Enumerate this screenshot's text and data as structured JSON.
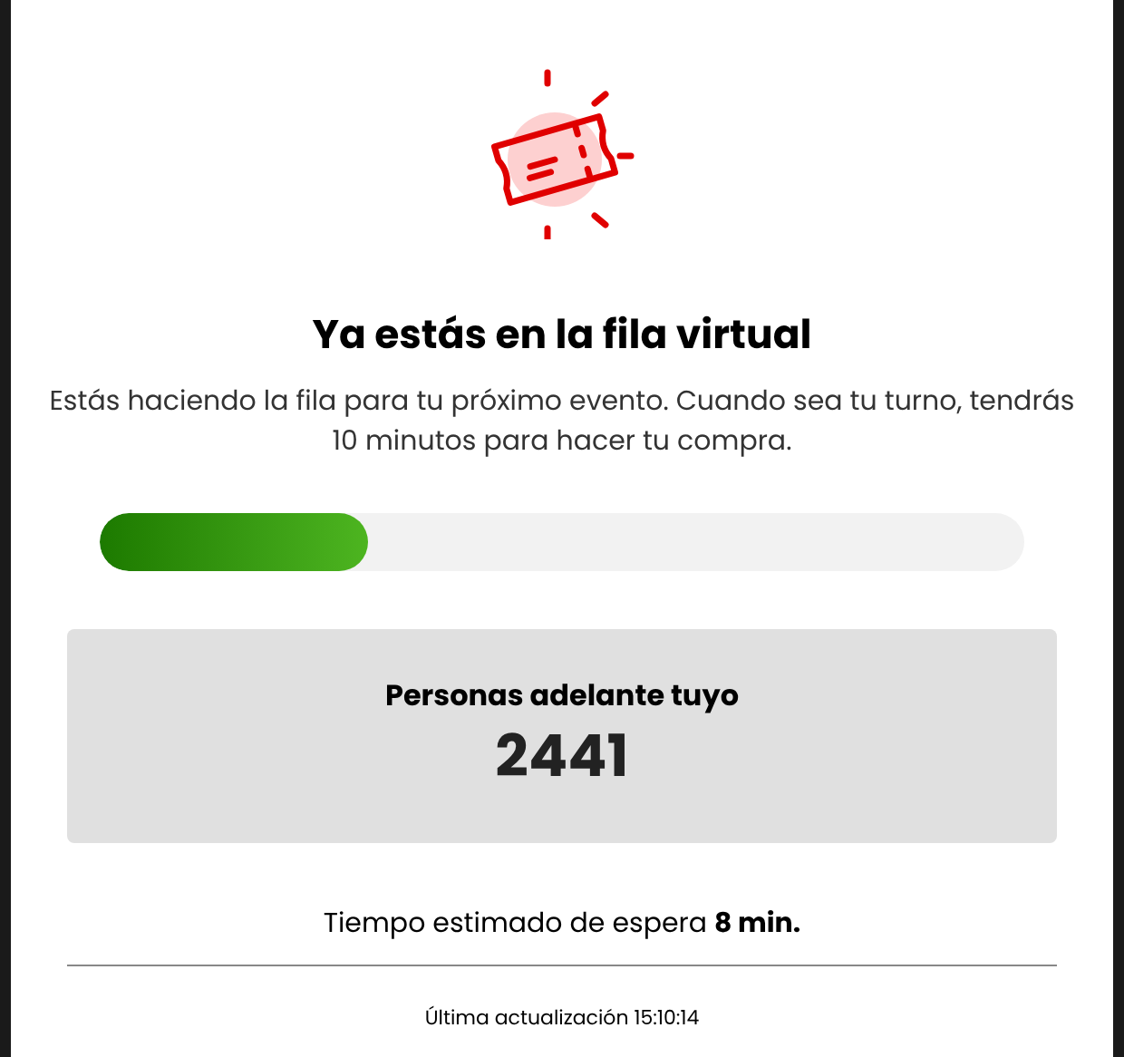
{
  "title": "Ya estás en la fila virtual",
  "description": "Estás haciendo la fila para tu próximo evento. Cuando sea tu turno, tendrás 10 minutos para hacer tu compra.",
  "progress": {
    "level": 0.29
  },
  "queue": {
    "label": "Personas adelante tuyo",
    "count": "2441"
  },
  "wait_time": "Tiempo estimado de espera **8 min.**",
  "last_update": "Última actualización 15:10:14"
}
